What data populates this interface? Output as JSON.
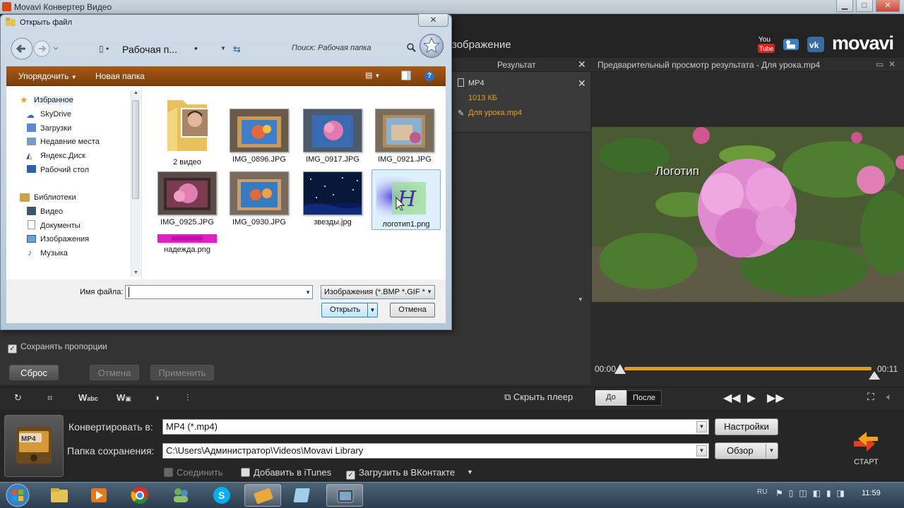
{
  "window": {
    "title": "Movavi Конвертер Видео"
  },
  "topbar": {
    "tab_label": "зображение",
    "logo_text": "movavi",
    "social": [
      "youtube-icon",
      "video-icon",
      "vk-icon"
    ]
  },
  "result_panel": {
    "header": "Результат",
    "format": "MP4",
    "size": "1013 КБ",
    "filename": "Для урока.mp4"
  },
  "preview": {
    "header": "Предварительный просмотр результата - Для урока.mp4",
    "overlay_text": "Логотип",
    "time_start": "00:00",
    "time_end": "00:11",
    "progress_fraction": 0.0
  },
  "settings": {
    "keep_proportions": "Сохранять пропорции",
    "reset": "Сброс",
    "cancel": "Отмена",
    "apply": "Применить"
  },
  "toolbar": {
    "hide_player": "Скрыть плеер",
    "before": "До",
    "after": "После"
  },
  "convert": {
    "format_icon_label": "MP4",
    "convert_label": "Конвертировать в:",
    "format_value": "MP4 (*.mp4)",
    "settings_btn": "Настройки",
    "folder_label": "Папка сохранения:",
    "folder_value": "C:\\Users\\Администратор\\Videos\\Movavi Library",
    "browse_btn": "Обзор",
    "opt_join": "Соединить",
    "opt_itunes": "Добавить в iTunes",
    "opt_vk": "Загрузить в ВКонтакте",
    "start": "СТАРТ"
  },
  "dialog": {
    "title": "Открыть файл",
    "address": "Рабочая п...",
    "search_placeholder": "Поиск: Рабочая папка",
    "organize": "Упорядочить",
    "new_folder": "Новая папка",
    "nav": {
      "favorites": "Избранное",
      "skydrive": "SkyDrive",
      "downloads": "Загрузки",
      "recent": "Недавние места",
      "yandex": "Яндекс.Диск",
      "desktop": "Рабочий стол",
      "libraries": "Библиотеки",
      "video": "Видео",
      "documents": "Документы",
      "images": "Изображения",
      "music": "Музыка"
    },
    "files": [
      {
        "name": "2 видео"
      },
      {
        "name": "IMG_0896.JPG"
      },
      {
        "name": "IMG_0917.JPG"
      },
      {
        "name": "IMG_0921.JPG"
      },
      {
        "name": "IMG_0925.JPG"
      },
      {
        "name": "IMG_0930.JPG"
      },
      {
        "name": "звезды.jpg"
      },
      {
        "name": "логотип1.png"
      },
      {
        "name": "надежда.png"
      }
    ],
    "filename_label": "Имя файла:",
    "filename_value": "",
    "filetype": "Изображения (*.BMP *.GIF *",
    "open": "Открыть",
    "cancel": "Отмена"
  },
  "taskbar": {
    "lang": "RU",
    "clock": "11:59"
  }
}
